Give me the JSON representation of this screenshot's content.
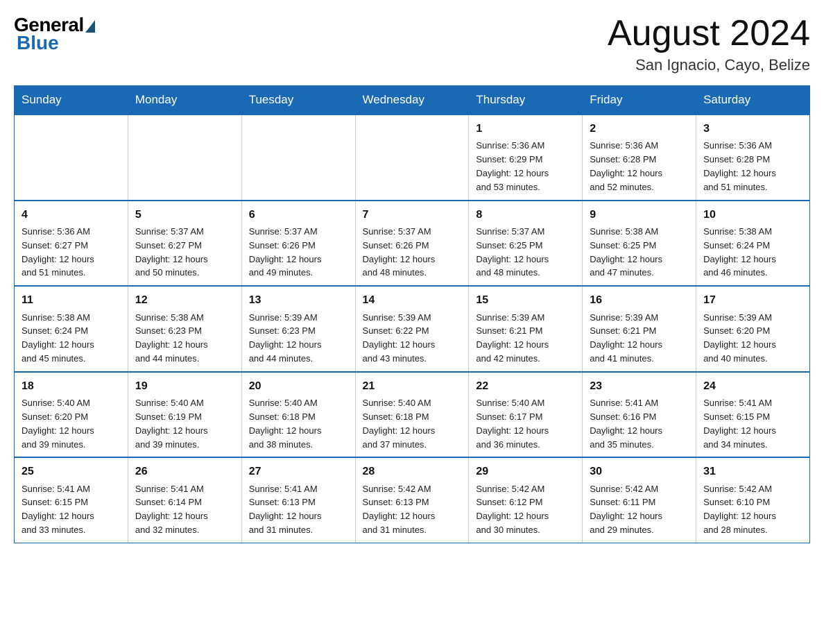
{
  "header": {
    "logo_general": "General",
    "logo_blue": "Blue",
    "month_title": "August 2024",
    "subtitle": "San Ignacio, Cayo, Belize"
  },
  "weekdays": [
    "Sunday",
    "Monday",
    "Tuesday",
    "Wednesday",
    "Thursday",
    "Friday",
    "Saturday"
  ],
  "weeks": [
    [
      {
        "day": "",
        "info": ""
      },
      {
        "day": "",
        "info": ""
      },
      {
        "day": "",
        "info": ""
      },
      {
        "day": "",
        "info": ""
      },
      {
        "day": "1",
        "info": "Sunrise: 5:36 AM\nSunset: 6:29 PM\nDaylight: 12 hours\nand 53 minutes."
      },
      {
        "day": "2",
        "info": "Sunrise: 5:36 AM\nSunset: 6:28 PM\nDaylight: 12 hours\nand 52 minutes."
      },
      {
        "day": "3",
        "info": "Sunrise: 5:36 AM\nSunset: 6:28 PM\nDaylight: 12 hours\nand 51 minutes."
      }
    ],
    [
      {
        "day": "4",
        "info": "Sunrise: 5:36 AM\nSunset: 6:27 PM\nDaylight: 12 hours\nand 51 minutes."
      },
      {
        "day": "5",
        "info": "Sunrise: 5:37 AM\nSunset: 6:27 PM\nDaylight: 12 hours\nand 50 minutes."
      },
      {
        "day": "6",
        "info": "Sunrise: 5:37 AM\nSunset: 6:26 PM\nDaylight: 12 hours\nand 49 minutes."
      },
      {
        "day": "7",
        "info": "Sunrise: 5:37 AM\nSunset: 6:26 PM\nDaylight: 12 hours\nand 48 minutes."
      },
      {
        "day": "8",
        "info": "Sunrise: 5:37 AM\nSunset: 6:25 PM\nDaylight: 12 hours\nand 48 minutes."
      },
      {
        "day": "9",
        "info": "Sunrise: 5:38 AM\nSunset: 6:25 PM\nDaylight: 12 hours\nand 47 minutes."
      },
      {
        "day": "10",
        "info": "Sunrise: 5:38 AM\nSunset: 6:24 PM\nDaylight: 12 hours\nand 46 minutes."
      }
    ],
    [
      {
        "day": "11",
        "info": "Sunrise: 5:38 AM\nSunset: 6:24 PM\nDaylight: 12 hours\nand 45 minutes."
      },
      {
        "day": "12",
        "info": "Sunrise: 5:38 AM\nSunset: 6:23 PM\nDaylight: 12 hours\nand 44 minutes."
      },
      {
        "day": "13",
        "info": "Sunrise: 5:39 AM\nSunset: 6:23 PM\nDaylight: 12 hours\nand 44 minutes."
      },
      {
        "day": "14",
        "info": "Sunrise: 5:39 AM\nSunset: 6:22 PM\nDaylight: 12 hours\nand 43 minutes."
      },
      {
        "day": "15",
        "info": "Sunrise: 5:39 AM\nSunset: 6:21 PM\nDaylight: 12 hours\nand 42 minutes."
      },
      {
        "day": "16",
        "info": "Sunrise: 5:39 AM\nSunset: 6:21 PM\nDaylight: 12 hours\nand 41 minutes."
      },
      {
        "day": "17",
        "info": "Sunrise: 5:39 AM\nSunset: 6:20 PM\nDaylight: 12 hours\nand 40 minutes."
      }
    ],
    [
      {
        "day": "18",
        "info": "Sunrise: 5:40 AM\nSunset: 6:20 PM\nDaylight: 12 hours\nand 39 minutes."
      },
      {
        "day": "19",
        "info": "Sunrise: 5:40 AM\nSunset: 6:19 PM\nDaylight: 12 hours\nand 39 minutes."
      },
      {
        "day": "20",
        "info": "Sunrise: 5:40 AM\nSunset: 6:18 PM\nDaylight: 12 hours\nand 38 minutes."
      },
      {
        "day": "21",
        "info": "Sunrise: 5:40 AM\nSunset: 6:18 PM\nDaylight: 12 hours\nand 37 minutes."
      },
      {
        "day": "22",
        "info": "Sunrise: 5:40 AM\nSunset: 6:17 PM\nDaylight: 12 hours\nand 36 minutes."
      },
      {
        "day": "23",
        "info": "Sunrise: 5:41 AM\nSunset: 6:16 PM\nDaylight: 12 hours\nand 35 minutes."
      },
      {
        "day": "24",
        "info": "Sunrise: 5:41 AM\nSunset: 6:15 PM\nDaylight: 12 hours\nand 34 minutes."
      }
    ],
    [
      {
        "day": "25",
        "info": "Sunrise: 5:41 AM\nSunset: 6:15 PM\nDaylight: 12 hours\nand 33 minutes."
      },
      {
        "day": "26",
        "info": "Sunrise: 5:41 AM\nSunset: 6:14 PM\nDaylight: 12 hours\nand 32 minutes."
      },
      {
        "day": "27",
        "info": "Sunrise: 5:41 AM\nSunset: 6:13 PM\nDaylight: 12 hours\nand 31 minutes."
      },
      {
        "day": "28",
        "info": "Sunrise: 5:42 AM\nSunset: 6:13 PM\nDaylight: 12 hours\nand 31 minutes."
      },
      {
        "day": "29",
        "info": "Sunrise: 5:42 AM\nSunset: 6:12 PM\nDaylight: 12 hours\nand 30 minutes."
      },
      {
        "day": "30",
        "info": "Sunrise: 5:42 AM\nSunset: 6:11 PM\nDaylight: 12 hours\nand 29 minutes."
      },
      {
        "day": "31",
        "info": "Sunrise: 5:42 AM\nSunset: 6:10 PM\nDaylight: 12 hours\nand 28 minutes."
      }
    ]
  ]
}
